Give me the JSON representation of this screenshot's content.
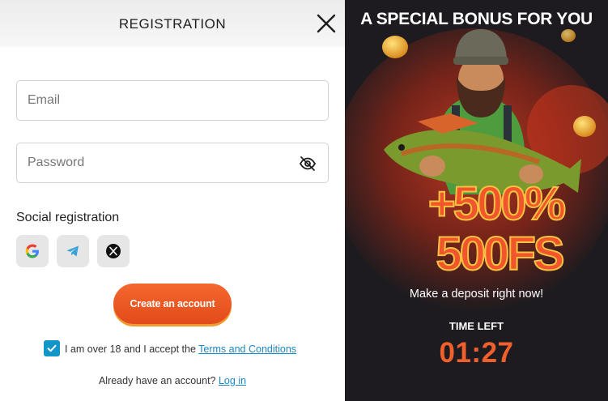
{
  "registration": {
    "title": "REGISTRATION",
    "email_placeholder": "Email",
    "password_placeholder": "Password",
    "social_title": "Social registration",
    "social_providers": [
      "google-icon",
      "telegram-icon",
      "x-icon"
    ],
    "create_button": "Create an account",
    "age_checkbox_checked": true,
    "age_text": "I am over 18 and I accept the ",
    "terms_link": "Terms and Conditions",
    "login_prompt": "Already have an account? ",
    "login_link": "Log in"
  },
  "promo": {
    "title": "A SPECIAL BONUS FOR YOU",
    "bonus_percent": "+500%",
    "bonus_fs": "500FS",
    "subtitle": "Make a deposit right now!",
    "timer_label": "TIME LEFT",
    "timer_value": "01:27"
  },
  "colors": {
    "accent_orange": "#f0602d",
    "link_blue": "#1b88c4",
    "checkbox_blue": "#1495c8",
    "promo_background": "#1d1b1f"
  }
}
